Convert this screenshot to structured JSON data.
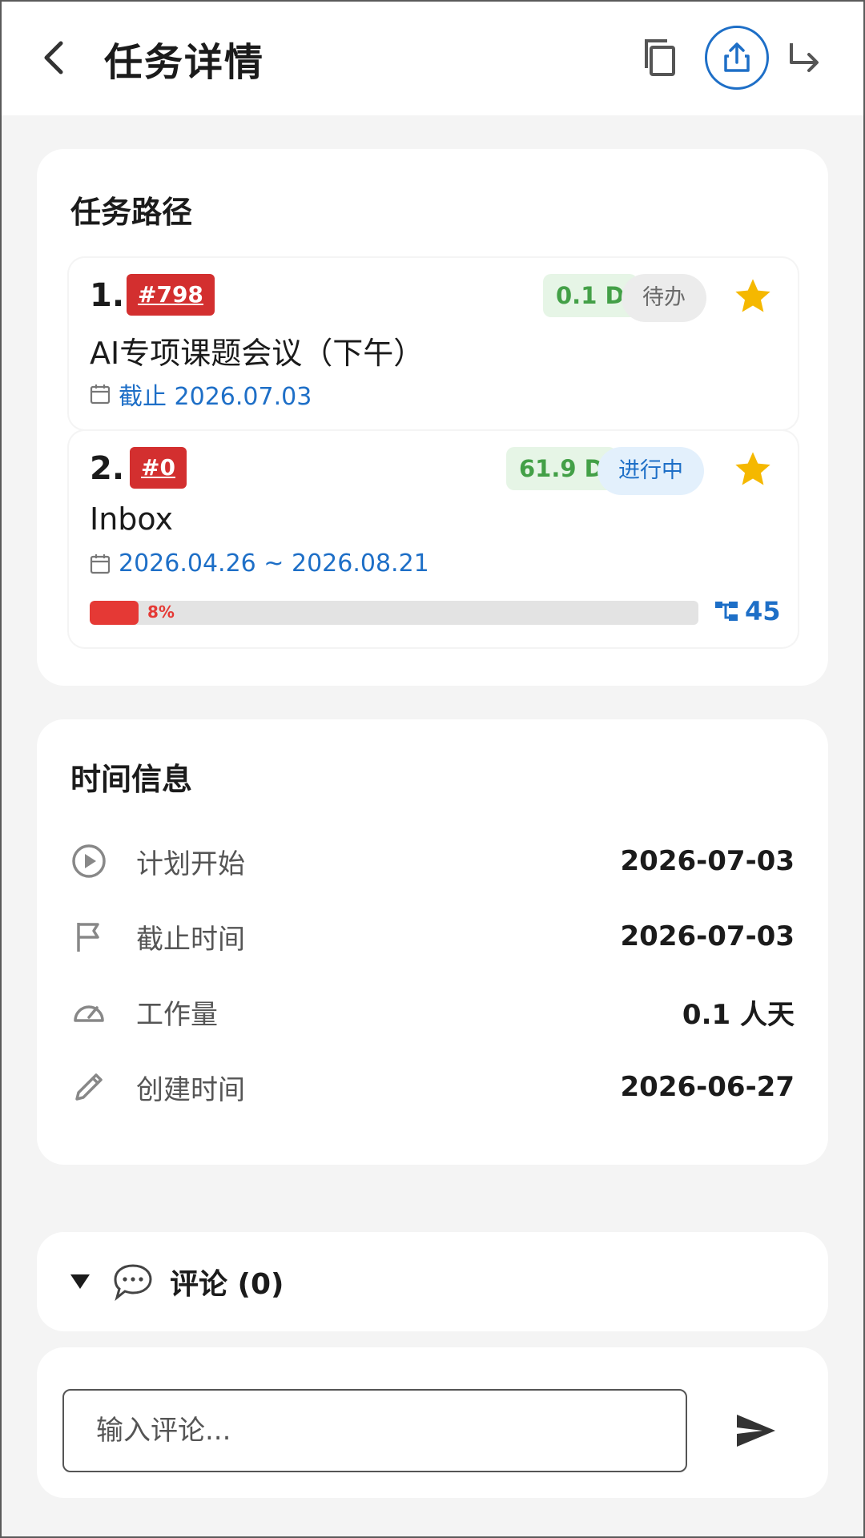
{
  "header": {
    "title": "任务详情",
    "icons": [
      "back-icon",
      "copy-icon",
      "share-icon",
      "forward-icon"
    ]
  },
  "task_path": {
    "title": "任务路径",
    "tasks": [
      {
        "num": "1.",
        "id": "#798",
        "duration": "0.1 D",
        "status": "待办",
        "name": "AI专项课题会议（下午）",
        "date": "截止 2026.07.03",
        "starred": true
      },
      {
        "num": "2.",
        "id": "#0",
        "duration": "61.9 D",
        "status": "进行中",
        "name": "Inbox",
        "date": "2026.04.26 ~ 2026.08.21",
        "starred": true,
        "progress": 0.08,
        "progress_label": "8%",
        "subtask_count": "45"
      }
    ]
  },
  "time_info": {
    "title": "时间信息",
    "rows": [
      {
        "icon": "play-circle-icon",
        "label": "计划开始",
        "value": "2026-07-03"
      },
      {
        "icon": "flag-icon",
        "label": "截止时间",
        "value": "2026-07-03"
      },
      {
        "icon": "speedometer-icon",
        "label": "工作量",
        "value": "0.1 人天"
      },
      {
        "icon": "pencil-icon",
        "label": "创建时间",
        "value": "2026-06-27"
      }
    ]
  },
  "comments": {
    "label": "评论 (0)",
    "input_placeholder": "输入评论..."
  },
  "colors": {
    "accent": "#1e6fc7",
    "id_badge": "#d32f2f",
    "duration_text": "#43a047",
    "star": "#f5b800",
    "progress": "#e53935"
  }
}
